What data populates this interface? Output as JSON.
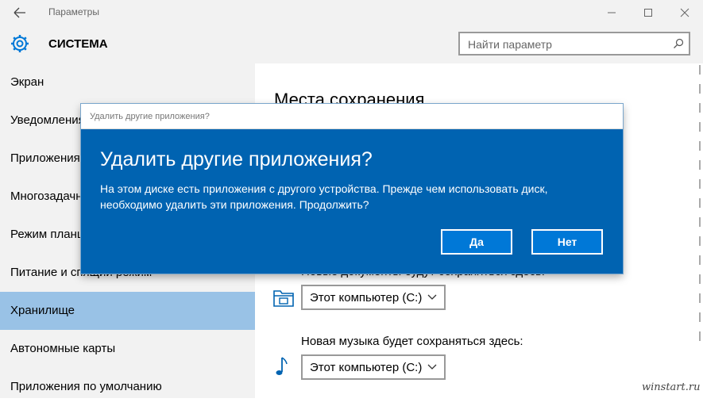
{
  "window": {
    "title": "Параметры"
  },
  "header": {
    "section_title": "СИСТЕМА",
    "search_placeholder": "Найти параметр"
  },
  "sidebar": {
    "items": [
      {
        "label": "Экран",
        "selected": false
      },
      {
        "label": "Уведомления и действия",
        "selected": false
      },
      {
        "label": "Приложения и возможности",
        "selected": false
      },
      {
        "label": "Многозадачность",
        "selected": false
      },
      {
        "label": "Режим планшета",
        "selected": false
      },
      {
        "label": "Питание и спящий режим",
        "selected": false
      },
      {
        "label": "Хранилище",
        "selected": true
      },
      {
        "label": "Автономные карты",
        "selected": false
      },
      {
        "label": "Приложения по умолчанию",
        "selected": false
      }
    ]
  },
  "main": {
    "title": "Места сохранения",
    "documents": {
      "label": "Новые документы будут сохраняться здесь:",
      "value": "Этот компьютер (C:)"
    },
    "music": {
      "label": "Новая музыка будет сохраняться здесь:",
      "value": "Этот компьютер (C:)"
    }
  },
  "dialog": {
    "title": "Удалить другие приложения?",
    "heading": "Удалить другие приложения?",
    "message": "На этом диске есть приложения с другого устройства. Прежде чем использовать диск, необходимо удалить эти приложения. Продолжить?",
    "yes_label": "Да",
    "no_label": "Нет"
  },
  "watermark": "winstart.ru",
  "colors": {
    "dialog_bg": "#0063b1",
    "selected_bg": "#99c2e6",
    "button_bg": "#0078d7",
    "accent": "#0078d7"
  }
}
